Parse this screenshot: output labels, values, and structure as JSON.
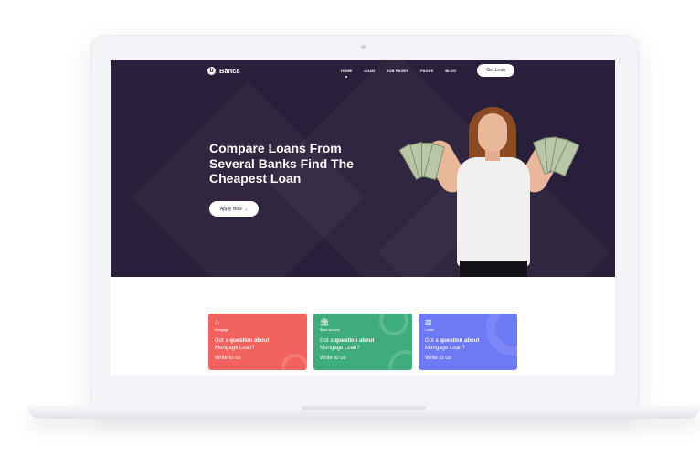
{
  "header": {
    "logo_mark": "b",
    "logo_text": "Banca",
    "nav": [
      {
        "label": "HOME",
        "active": true
      },
      {
        "label": "LOAN",
        "active": false
      },
      {
        "label": "JOB PAGES",
        "active": false
      },
      {
        "label": "PAGES",
        "active": false
      },
      {
        "label": "BLOG",
        "active": false
      }
    ],
    "cta_label": "Get Loan"
  },
  "hero": {
    "headline_line1": "Compare Loans From",
    "headline_line2": "Several Banks Find The",
    "headline_line3": "Cheapest Loan",
    "apply_label": "Apply Now →"
  },
  "cards": [
    {
      "icon": "house-icon",
      "icon_glyph": "⌂",
      "tag": "Mortgage",
      "q_prefix": "Got a ",
      "q_bold": "question about",
      "q_rest": "Mortgage Loan?",
      "link": "Write to us",
      "color": "#f2625f"
    },
    {
      "icon": "bank-icon",
      "icon_glyph": "🏛",
      "tag": "Bank account",
      "q_prefix": "Got a ",
      "q_bold": "question about",
      "q_rest": "Mortgage Loan?",
      "link": "Write to us",
      "color": "#3fac7c"
    },
    {
      "icon": "loans-icon",
      "icon_glyph": "▥",
      "tag": "Loans",
      "q_prefix": "Got a ",
      "q_bold": "question about",
      "q_rest": "Mortgage Loan?",
      "link": "Write to us",
      "color": "#6e79f6"
    }
  ],
  "colors": {
    "hero_bg": "#2a1f3a",
    "accent_red": "#f2625f",
    "accent_green": "#3fac7c",
    "accent_blue": "#6e79f6"
  }
}
